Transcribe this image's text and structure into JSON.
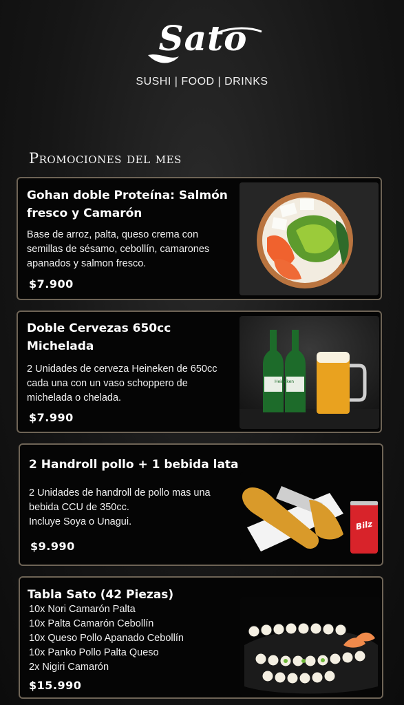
{
  "brand": {
    "logo_text": "Sato",
    "tagline": "SUSHI | FOOD | DRINKS"
  },
  "section": {
    "title": "Promociones del mes"
  },
  "promos": [
    {
      "title_lines": [
        "Gohan doble Proteína: Salmón",
        "fresco y Camarón"
      ],
      "description_lines": [
        "Base de arroz, palta, queso crema con",
        "semillas de sésamo, cebollín, camarones",
        "apanados y salmon fresco."
      ],
      "price": "$7.900",
      "image": "poke-bowl-photo"
    },
    {
      "title_lines": [
        "Doble Cervezas 650cc",
        "Michelada"
      ],
      "description_lines": [
        "2 Unidades de cerveza Heineken de 650cc",
        "cada una con un vaso schoppero de",
        "michelada o chelada."
      ],
      "price": "$7.990",
      "image": "beer-bottles-photo"
    },
    {
      "title_lines": [
        "2 Handroll pollo + 1 bebida lata"
      ],
      "description_lines": [
        "2 Unidades de handroll de pollo mas una",
        "bebida CCU de 350cc.",
        "Incluye Soya o Unagui."
      ],
      "price": "$9.990",
      "image": "handroll-can-photo",
      "can_label": "Bilz"
    },
    {
      "title_lines": [
        "Tabla Sato (42 Piezas)"
      ],
      "description_lines": [
        "10x Nori Camarón Palta",
        "10x Palta Camarón Cebollín",
        "10x Queso Pollo Apanado Cebollín",
        "10x Panko Pollo Palta Queso",
        "2x Nigiri Camarón"
      ],
      "price": "$15.990",
      "image": "sushi-platter-photo"
    }
  ],
  "beer_label": "Heineken",
  "colors": {
    "background": "#161616",
    "card": "#050505",
    "card_border": "#6e6456",
    "text": "#ffffff"
  }
}
